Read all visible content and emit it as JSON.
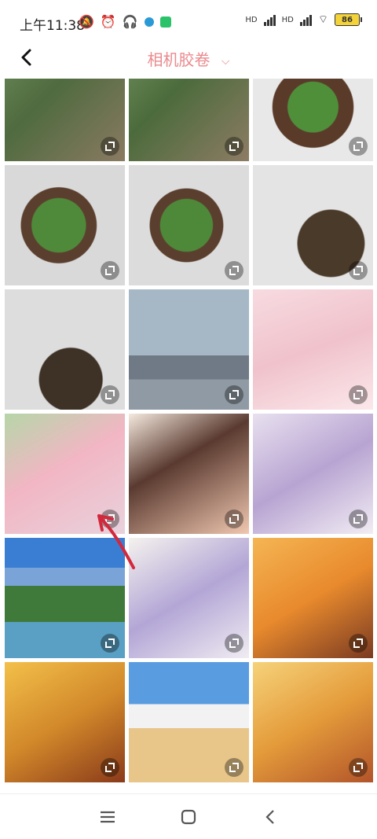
{
  "status_bar": {
    "time": "上午11:38",
    "signal_1": "HD",
    "signal_2": "HD",
    "battery": "86"
  },
  "header": {
    "title": "相机胶卷"
  },
  "tiles": [
    {
      "name": "plant-leaves",
      "bg": "linear-gradient(135deg,#6b8a5a,#4f6b3f 40%,#8a7a62)"
    },
    {
      "name": "plant-leaves-2",
      "bg": "linear-gradient(135deg,#6f8e5c,#4c6b3c 40%,#8d7c64)"
    },
    {
      "name": "succulent-pot",
      "bg": "radial-gradient(circle at 50% 55%,#4f8f3a 0 28%,#5a3b2a 29% 45%,#e8e8e8 46%)"
    },
    {
      "name": "succulent-1",
      "bg": "radial-gradient(circle at 45% 50%,#4f8a3a 0 30%,#5b3f2e 31% 42%,#d9d9d9 43%)"
    },
    {
      "name": "succulent-2",
      "bg": "radial-gradient(circle at 48% 50%,#4e893a 0 30%,#5b3f2e 31% 42%,#dcdcdc 43%)"
    },
    {
      "name": "plant-stem-pot",
      "bg": "radial-gradient(circle at 65% 65%,#4a3a2a 0 30%,#e4e4e4 31%)"
    },
    {
      "name": "plant-stem-pot-2",
      "bg": "radial-gradient(circle at 55% 75%,#3e3126 0 28%,#dddddd 29%)"
    },
    {
      "name": "city-skyline",
      "bg": "linear-gradient(180deg,#a6b7c6 0 55%,#6f7a86 55% 75%,#8f9aa4 75%)"
    },
    {
      "name": "anime-girl-fortune",
      "bg": "linear-gradient(160deg,#f7dbe0,#f0c2cc 50%,#fbe8ea)"
    },
    {
      "name": "anime-girl-pink-hair",
      "bg": "linear-gradient(150deg,#b6d6a8,#f2b6c4 45%,#e8d2dc)"
    },
    {
      "name": "anime-girl-flowers",
      "bg": "linear-gradient(150deg,#f5e9de,#5a3a30 40%,#f0c7b0)"
    },
    {
      "name": "anime-girl-lavender",
      "bg": "linear-gradient(150deg,#e8e0ef,#b8a4d2 50%,#f2edf4)"
    },
    {
      "name": "river-landscape",
      "bg": "linear-gradient(180deg,#3a7ed4 0 25%,#7aa3d8 25% 40%,#3f7a3a 40% 70%,#5aa0c4 70%)"
    },
    {
      "name": "anime-girl-purple",
      "bg": "linear-gradient(150deg,#f5f2ee,#b3a6d6 50%,#f0ecf2)"
    },
    {
      "name": "chibi-girl-gold",
      "bg": "linear-gradient(150deg,#f5b553,#e88a2d 50%,#7a3a22)"
    },
    {
      "name": "chibi-girl-coins",
      "bg": "linear-gradient(150deg,#f3c04a,#d2892a 50%,#8a3a1a)"
    },
    {
      "name": "sky-building",
      "bg": "linear-gradient(180deg,#5a9ce0 0 35%,#f2f2f2 35% 55%,#e8c68a 55%)"
    },
    {
      "name": "chibi-girl-coins-2",
      "bg": "linear-gradient(150deg,#f6d27a,#e49b3a 50%,#b2542a)"
    }
  ],
  "navbar": {
    "menu": "menu-icon",
    "home": "home-icon",
    "back": "back-icon"
  }
}
